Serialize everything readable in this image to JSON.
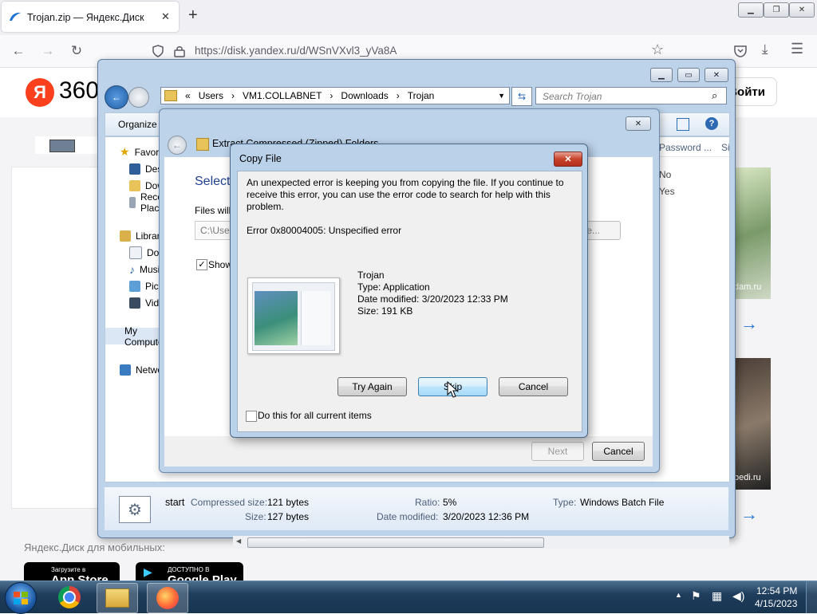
{
  "browser": {
    "tab_title": "Trojan.zip — Яндекс.Диск",
    "new_tab": "+",
    "tab_close": "✕",
    "url": "https://disk.yandex.ru/d/WSnVXvl3_yVa8A"
  },
  "yandex": {
    "logo_letter": "Я",
    "logo_text": "360",
    "login_button": "Войти",
    "mobile_label": "Яндекс.Диск для мобильных:",
    "app_store_small": "Загрузите в",
    "app_store": "App Store",
    "google_play_small": "ДОСТУПНО В",
    "google_play": "Google Play",
    "card1_caption": "dam.ru",
    "card2_caption": "bedi.ru"
  },
  "explorer": {
    "breadcrumb": [
      "Users",
      "VM1.COLLABNET",
      "Downloads",
      "Trojan"
    ],
    "search_placeholder": "Search Trojan",
    "organize": "Organize",
    "nav": [
      {
        "label": "Favorites",
        "icon": "star-icon"
      },
      {
        "label": "Desktop",
        "icon": "desktop-icon"
      },
      {
        "label": "Downloads",
        "icon": "folder-icon"
      },
      {
        "label": "Recent Places",
        "icon": "recent-icon"
      },
      {
        "label": "Libraries",
        "icon": "library-icon"
      },
      {
        "label": "Documents",
        "icon": "documents-icon"
      },
      {
        "label": "Music",
        "icon": "music-icon"
      },
      {
        "label": "Pictures",
        "icon": "pictures-icon"
      },
      {
        "label": "Videos",
        "icon": "videos-icon"
      },
      {
        "label": "My Computer",
        "icon": "computer-icon"
      },
      {
        "label": "Network",
        "icon": "network-icon"
      }
    ],
    "columns": [
      "Password ...",
      "Si"
    ],
    "rows": [
      "No",
      "Yes"
    ],
    "details": {
      "name": "start",
      "compressed_label": "Compressed size:",
      "compressed_value": "121 bytes",
      "size_label": "Size:",
      "size_value": "127 bytes",
      "ratio_label": "Ratio:",
      "ratio_value": "5%",
      "date_label": "Date modified:",
      "date_value": "3/20/2023 12:36 PM",
      "type_label": "Type:",
      "type_value": "Windows Batch File"
    }
  },
  "wizard": {
    "title": "Extract Compressed (Zipped) Folders",
    "heading": "Select",
    "files_label": "Files will",
    "path_value": "C:\\Users",
    "browse": "Browse...",
    "show_label": "Show",
    "next": "Next",
    "cancel": "Cancel"
  },
  "copy_dialog": {
    "title": "Copy File",
    "message": "An unexpected error is keeping you from copying the file. If you continue to receive this error, you can use the error code to search for help with this problem.",
    "error": "Error 0x80004005: Unspecified error",
    "file_name": "Trojan",
    "file_type": "Type: Application",
    "file_date": "Date modified: 3/20/2023 12:33 PM",
    "file_size": "Size: 191 KB",
    "try_again": "Try Again",
    "skip": "Skip",
    "cancel": "Cancel",
    "checkbox_label": "Do this for all current items"
  },
  "taskbar": {
    "time": "12:54 PM",
    "date": "4/15/2023"
  }
}
